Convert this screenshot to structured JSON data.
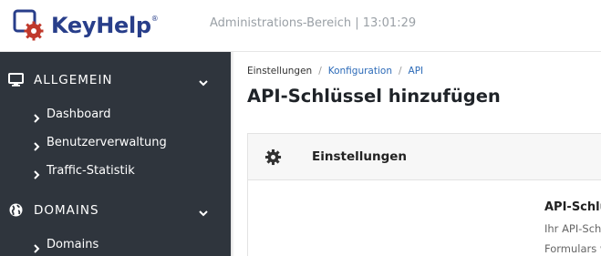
{
  "header": {
    "logo_text": "KeyHelp",
    "registered_mark": "®",
    "info": "Administrations-Bereich | 13:01:29",
    "colors": {
      "brand_blue": "#283e8a",
      "brand_red": "#c0392b"
    }
  },
  "sidebar": {
    "sections": [
      {
        "icon": "monitor-icon",
        "label": "ALLGEMEIN",
        "items": [
          {
            "label": "Dashboard"
          },
          {
            "label": "Benutzerverwaltung"
          },
          {
            "label": "Traffic-Statistik"
          }
        ]
      },
      {
        "icon": "globe-icon",
        "label": "DOMAINS",
        "items": [
          {
            "label": "Domains"
          }
        ]
      }
    ]
  },
  "breadcrumb": {
    "items": [
      "Einstellungen",
      "Konfiguration",
      "API"
    ],
    "separator": "/"
  },
  "page_title": "API-Schlüssel hinzufügen",
  "card": {
    "icon": "gear-icon",
    "title": "Einstellungen",
    "body_title": "API-Schlü",
    "body_lines": [
      "Ihr API-Sch",
      "Formulars w"
    ]
  }
}
